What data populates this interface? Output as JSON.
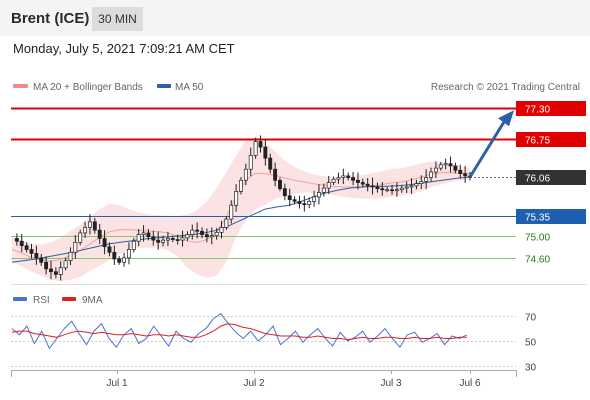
{
  "header": {
    "title": "Brent (ICE)",
    "timeframe": "30 MIN"
  },
  "datetime": "Monday, July 5, 2021 7:09:21 AM CET",
  "legend": {
    "bollinger": "MA 20 + Bollinger Bands",
    "ma50": "MA 50",
    "credit": "Research © 2021 Trading Central"
  },
  "rsi_legend": {
    "rsi": "RSI",
    "ma9": "9MA"
  },
  "colors": {
    "resistance": "#e00000",
    "support_blue": "#1f5fb0",
    "support_green": "#4a9a2a",
    "current": "#333333",
    "bollinger": "#f7cccc",
    "ma50": "#2f5fa6",
    "candle": "#222222",
    "rsi": "#4a72d0",
    "rsi_ma": "#e02020",
    "arrow": "#2f5fa6"
  },
  "chart_data": [
    {
      "type": "candlestick",
      "title": "Brent (ICE)",
      "timeframe": "30 MIN",
      "ylim": [
        74.2,
        77.45
      ],
      "x_ticks": [
        "Jul 1",
        "Jul 2",
        "Jul 3",
        "Jul 6"
      ],
      "levels": [
        {
          "value": 77.3,
          "label": "77.30",
          "kind": "resistance"
        },
        {
          "value": 76.75,
          "label": "76.75",
          "kind": "resistance"
        },
        {
          "value": 76.06,
          "label": "76.06",
          "kind": "current"
        },
        {
          "value": 75.35,
          "label": "75.35",
          "kind": "support_blue"
        },
        {
          "value": 75.0,
          "label": "75.00",
          "kind": "support_green"
        },
        {
          "value": 74.6,
          "label": "74.60",
          "kind": "support_green"
        }
      ],
      "close_series": [
        74.95,
        74.9,
        74.82,
        74.75,
        74.68,
        74.6,
        74.52,
        74.4,
        74.35,
        74.3,
        74.42,
        74.55,
        74.7,
        74.88,
        75.05,
        75.15,
        75.25,
        75.1,
        74.95,
        74.8,
        74.7,
        74.58,
        74.52,
        74.6,
        74.75,
        74.9,
        75.02,
        75.05,
        74.98,
        74.92,
        74.88,
        74.92,
        74.95,
        74.93,
        74.92,
        74.96,
        75.02,
        75.1,
        75.08,
        75.02,
        74.98,
        75.0,
        75.06,
        75.15,
        75.3,
        75.55,
        75.8,
        76.0,
        76.2,
        76.45,
        76.7,
        76.6,
        76.4,
        76.2,
        76.0,
        75.85,
        75.72,
        75.65,
        75.62,
        75.58,
        75.56,
        75.62,
        75.7,
        75.78,
        75.86,
        75.96,
        76.02,
        76.05,
        76.08,
        76.05,
        76.0,
        75.96,
        75.93,
        75.9,
        75.88,
        75.85,
        75.83,
        75.83,
        75.82,
        75.83,
        75.86,
        75.88,
        75.9,
        75.94,
        75.98,
        76.05,
        76.15,
        76.22,
        76.28,
        76.3,
        76.26,
        76.18,
        76.12,
        76.08,
        76.06
      ],
      "bollinger_upper": [
        74.98,
        74.92,
        74.86,
        74.84,
        74.88,
        74.96,
        75.08,
        75.2,
        75.34,
        75.48,
        75.58,
        75.55,
        75.48,
        75.42,
        75.38,
        75.37,
        75.36,
        75.36,
        75.38,
        75.46,
        75.62,
        75.86,
        76.15,
        76.45,
        76.72,
        76.78,
        76.68,
        76.52,
        76.36,
        76.24,
        76.16,
        76.1,
        76.07,
        76.05,
        76.06,
        76.08,
        76.1,
        76.13,
        76.17,
        76.21,
        76.22,
        76.26,
        76.31,
        76.34,
        76.34,
        76.3,
        76.25,
        76.22
      ],
      "bollinger_lower": [
        74.52,
        74.45,
        74.35,
        74.28,
        74.2,
        74.18,
        74.2,
        74.26,
        74.36,
        74.46,
        74.56,
        74.66,
        74.74,
        74.78,
        74.78,
        74.78,
        74.74,
        74.62,
        74.42,
        74.3,
        74.24,
        74.28,
        74.52,
        74.98,
        75.28,
        75.48,
        75.56,
        75.66,
        75.72,
        75.76,
        75.78,
        75.77,
        75.76,
        75.73,
        75.7,
        75.68,
        75.67,
        75.67,
        75.68,
        75.7,
        75.72,
        75.76,
        75.8,
        75.88,
        75.93,
        75.97,
        76.0,
        76.02
      ],
      "ma50": [
        74.52,
        74.55,
        74.58,
        74.62,
        74.66,
        74.7,
        74.75,
        74.8,
        74.85,
        74.88,
        74.91,
        74.94,
        74.96,
        74.98,
        75.0,
        75.02,
        75.05,
        75.1,
        75.18,
        75.28,
        75.38,
        75.48,
        75.52,
        75.55,
        75.62,
        75.7,
        75.77,
        75.82,
        75.86,
        75.88,
        75.89,
        75.89,
        75.9,
        75.92,
        75.95,
        75.98,
        76.01,
        76.04,
        76.06
      ]
    },
    {
      "type": "line",
      "title": "RSI",
      "ylim": [
        25,
        75
      ],
      "y_ticks": [
        70,
        50,
        30
      ],
      "series": [
        {
          "name": "RSI",
          "values": [
            60,
            55,
            62,
            48,
            58,
            44,
            52,
            60,
            66,
            56,
            47,
            58,
            64,
            52,
            45,
            55,
            60,
            48,
            52,
            62,
            54,
            46,
            58,
            52,
            49,
            56,
            60,
            68,
            72,
            64,
            57,
            52,
            58,
            50,
            55,
            62,
            47,
            52,
            58,
            49,
            55,
            60,
            52,
            46,
            57,
            50,
            53,
            58,
            49,
            54,
            60,
            52,
            45,
            55,
            57,
            49,
            52,
            56,
            47,
            54,
            52,
            55
          ]
        },
        {
          "name": "9MA",
          "values": [
            57,
            58,
            58,
            56,
            55,
            54,
            53,
            55,
            57,
            58,
            57,
            56,
            57,
            56,
            55,
            55,
            56,
            55,
            54,
            55,
            55,
            54,
            55,
            54,
            53,
            53,
            55,
            58,
            62,
            64,
            63,
            61,
            60,
            58,
            56,
            55,
            54,
            54,
            54,
            53,
            53,
            54,
            53,
            52,
            52,
            51,
            52,
            53,
            52,
            52,
            53,
            53,
            52,
            52,
            53,
            52,
            52,
            53,
            52,
            52,
            53,
            53
          ]
        }
      ]
    }
  ]
}
